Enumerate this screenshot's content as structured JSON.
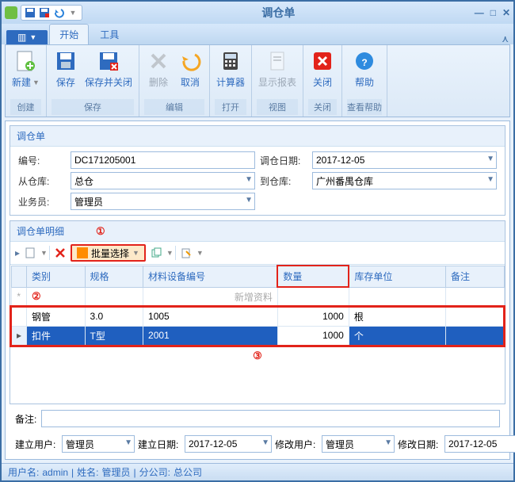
{
  "window": {
    "title": "调仓单"
  },
  "tabs": {
    "file": "▥ ▾",
    "t0": "开始",
    "t1": "工具"
  },
  "ribbon": {
    "create": {
      "new": "新建",
      "group": "创建"
    },
    "save": {
      "save": "保存",
      "saveclose": "保存并关闭",
      "group": "保存"
    },
    "edit": {
      "delete": "删除",
      "cancel": "取消",
      "group": "编辑"
    },
    "open": {
      "calc": "计算器",
      "group": "打开"
    },
    "view": {
      "report": "显示报表",
      "group": "视图"
    },
    "close": {
      "close": "关闭",
      "group": "关闭"
    },
    "help": {
      "help": "帮助",
      "group": "查看帮助"
    }
  },
  "hdr": {
    "title": "调仓单",
    "no_l": "编号:",
    "no_v": "DC171205001",
    "date_l": "调仓日期:",
    "date_v": "2017-12-05",
    "from_l": "从仓库:",
    "from_v": "总仓",
    "to_l": "到仓库:",
    "to_v": "广州番禺仓库",
    "op_l": "业务员:",
    "op_v": "管理员"
  },
  "detail": {
    "title": "调仓单明细",
    "batch": "批量选择",
    "cols": {
      "c0": "类别",
      "c1": "规格",
      "c2": "材料设备编号",
      "c3": "数量",
      "c4": "库存单位",
      "c5": "备注"
    },
    "newrow": "新增资料",
    "rows": [
      {
        "cat": "钢管",
        "spec": "3.0",
        "code": "1005",
        "qty": "1000",
        "unit": "根",
        "note": ""
      },
      {
        "cat": "扣件",
        "spec": "T型",
        "code": "2001",
        "qty": "1000",
        "unit": "个",
        "note": ""
      }
    ]
  },
  "marks": {
    "m1": "①",
    "m2": "②",
    "m3": "③"
  },
  "note": {
    "label": "备注:",
    "value": ""
  },
  "ftr": {
    "cu_l": "建立用户:",
    "cu_v": "管理员",
    "cd_l": "建立日期:",
    "cd_v": "2017-12-05",
    "mu_l": "修改用户:",
    "mu_v": "管理员",
    "md_l": "修改日期:",
    "md_v": "2017-12-05"
  },
  "status": {
    "u_l": "用户名:",
    "u_v": "admin",
    "n_l": "姓名:",
    "n_v": "管理员",
    "b_l": "分公司:",
    "b_v": "总公司",
    "sep": " | "
  }
}
